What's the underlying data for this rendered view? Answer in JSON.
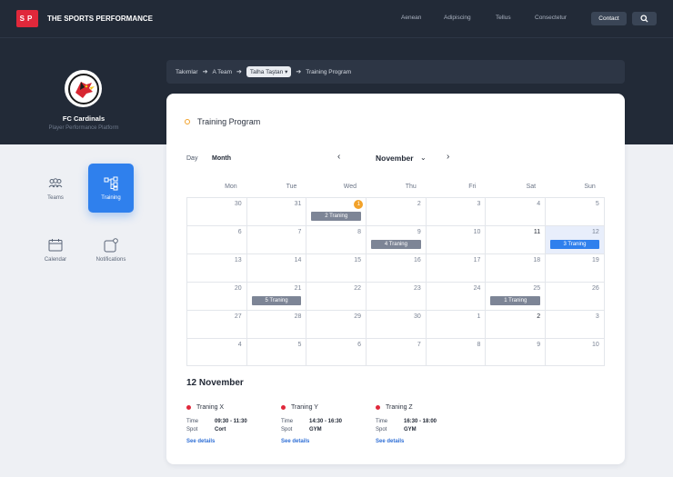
{
  "brand": {
    "mark": "SP",
    "name": "THE SPORTS PERFORMANCE"
  },
  "nav": {
    "links": [
      "Aenean",
      "Adipiscing",
      "Tellus",
      "Consectetur"
    ],
    "contact": "Contact"
  },
  "club": {
    "name": "FC Cardinals",
    "subtitle": "Player Performance Platform"
  },
  "sidebar": {
    "items": [
      {
        "label": "Teams",
        "icon": "teams-icon",
        "active": false
      },
      {
        "label": "Training",
        "icon": "training-icon",
        "active": true
      },
      {
        "label": "Calendar",
        "icon": "calendar-icon",
        "active": false
      },
      {
        "label": "Notifications",
        "icon": "notifications-icon",
        "active": false
      }
    ]
  },
  "breadcrumb": {
    "items": [
      "Takımlar",
      "A Team",
      "Talha Taştan",
      "Training  Program"
    ]
  },
  "program": {
    "title": "Training Program",
    "views": {
      "day": "Day",
      "month": "Month"
    },
    "month": "November",
    "weekdays": [
      "Mon",
      "Tue",
      "Wed",
      "Thu",
      "Fri",
      "Sat",
      "Sun"
    ],
    "weeks": [
      [
        {
          "d": "30"
        },
        {
          "d": "31"
        },
        {
          "d": "1",
          "badge": "1",
          "event": "2 Traning"
        },
        {
          "d": "2"
        },
        {
          "d": "3"
        },
        {
          "d": "4"
        },
        {
          "d": "5"
        }
      ],
      [
        {
          "d": "6"
        },
        {
          "d": "7"
        },
        {
          "d": "8"
        },
        {
          "d": "9",
          "event": "4 Traning"
        },
        {
          "d": "10"
        },
        {
          "d": "11",
          "strong": true
        },
        {
          "d": "12",
          "selected": true,
          "event": "3 Traning"
        }
      ],
      [
        {
          "d": "13"
        },
        {
          "d": "14"
        },
        {
          "d": "15"
        },
        {
          "d": "16"
        },
        {
          "d": "17"
        },
        {
          "d": "18"
        },
        {
          "d": "19"
        }
      ],
      [
        {
          "d": "20"
        },
        {
          "d": "21",
          "event": "5 Traning"
        },
        {
          "d": "22"
        },
        {
          "d": "23"
        },
        {
          "d": "24"
        },
        {
          "d": "25",
          "event": "1 Traning"
        },
        {
          "d": "26"
        }
      ],
      [
        {
          "d": "27"
        },
        {
          "d": "28"
        },
        {
          "d": "29"
        },
        {
          "d": "30"
        },
        {
          "d": "1"
        },
        {
          "d": "2",
          "strong": true
        },
        {
          "d": "3"
        }
      ],
      [
        {
          "d": "4"
        },
        {
          "d": "5"
        },
        {
          "d": "6"
        },
        {
          "d": "7"
        },
        {
          "d": "8"
        },
        {
          "d": "9"
        },
        {
          "d": "10"
        }
      ]
    ]
  },
  "selected_day": {
    "heading": "12 November",
    "trainings": [
      {
        "name": "Traning X",
        "time_label": "Time",
        "time": "09:30 - 11:30",
        "spot_label": "Spot",
        "spot": "Cort",
        "link": "See details"
      },
      {
        "name": "Traning Y",
        "time_label": "Time",
        "time": "14:30 - 16:30",
        "spot_label": "Spot",
        "spot": "GYM",
        "link": "See details"
      },
      {
        "name": "Traning Z",
        "time_label": "Time",
        "time": "16:30 - 18:00",
        "spot_label": "Spot",
        "spot": "GYM",
        "link": "See details"
      }
    ]
  },
  "colors": {
    "accent": "#2f80ed",
    "brand_red": "#e0283b",
    "dark": "#222a37",
    "badge": "#f2a22a"
  }
}
